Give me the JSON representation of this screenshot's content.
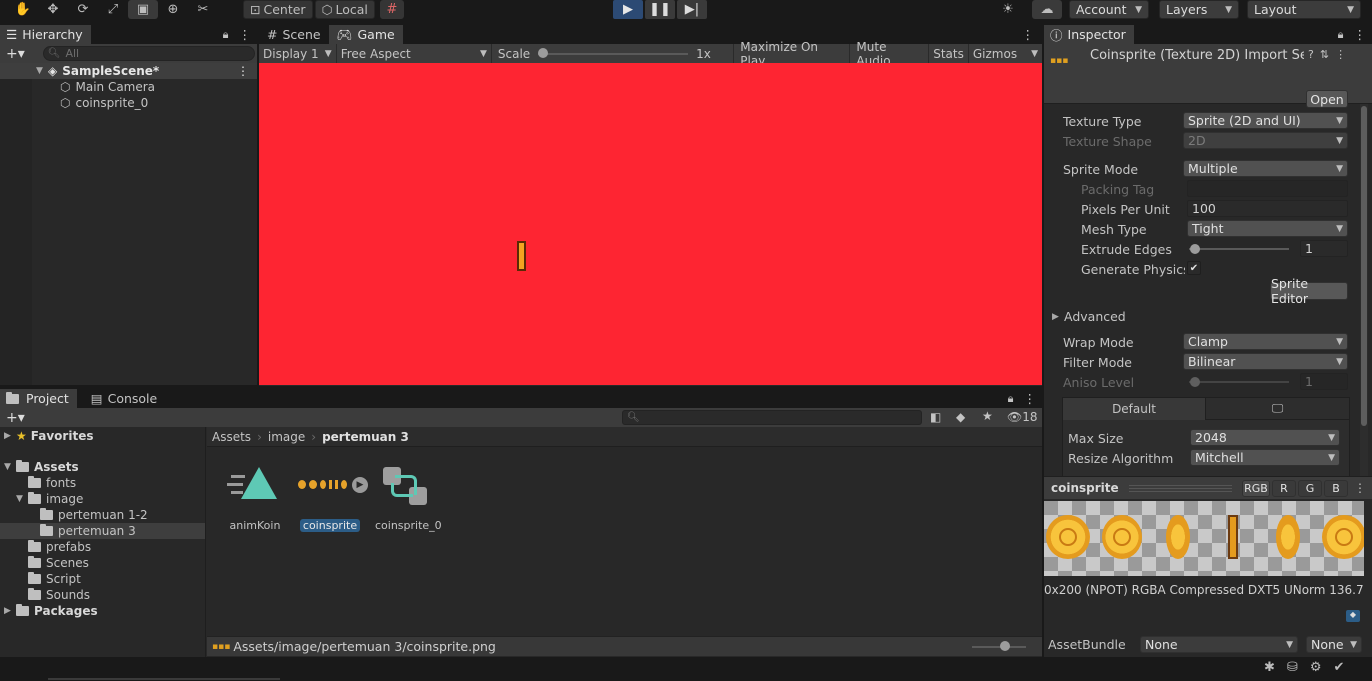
{
  "toolbar": {
    "pivot_center": "Center",
    "pivot_local": "Local",
    "account": "Account",
    "layers": "Layers",
    "layout": "Layout",
    "tools": [
      "hand-icon",
      "move-icon",
      "rotate-icon",
      "scale-icon",
      "rect-icon",
      "transform-icon",
      "custom-tool-icon"
    ]
  },
  "hierarchy": {
    "tab": "Hierarchy",
    "search_placeholder": "All",
    "scene": "SampleScene*",
    "items": [
      "Main Camera",
      "coinsprite_0"
    ]
  },
  "game": {
    "tab_scene": "Scene",
    "tab_game": "Game",
    "display": "Display 1",
    "aspect": "Free Aspect",
    "scale_label": "Scale",
    "scale_value": "1x",
    "maximize": "Maximize On Play",
    "mute": "Mute Audio",
    "stats": "Stats",
    "gizmos": "Gizmos",
    "background_color": "#fe2532"
  },
  "project": {
    "tab_project": "Project",
    "tab_console": "Console",
    "hidden_count": "18",
    "favorites": "Favorites",
    "assets": "Assets",
    "folders": [
      {
        "name": "fonts",
        "indent": 1
      },
      {
        "name": "image",
        "indent": 1
      },
      {
        "name": "pertemuan 1-2",
        "indent": 2
      },
      {
        "name": "pertemuan 3",
        "indent": 2
      },
      {
        "name": "prefabs",
        "indent": 1
      },
      {
        "name": "Scenes",
        "indent": 1
      },
      {
        "name": "Script",
        "indent": 1
      },
      {
        "name": "Sounds",
        "indent": 1
      }
    ],
    "packages": "Packages",
    "breadcrumb": [
      "Assets",
      "image",
      "pertemuan 3"
    ],
    "assets_grid": [
      "animKoin",
      "coinsprite",
      "coinsprite_0"
    ],
    "status_path": "Assets/image/pertemuan 3/coinsprite.png"
  },
  "inspector": {
    "tab": "Inspector",
    "title": "Coinsprite (Texture 2D) Import Se",
    "open": "Open",
    "texture_type_label": "Texture Type",
    "texture_type": "Sprite (2D and UI)",
    "texture_shape_label": "Texture Shape",
    "texture_shape": "2D",
    "sprite_mode_label": "Sprite Mode",
    "sprite_mode": "Multiple",
    "packing_tag_label": "Packing Tag",
    "ppu_label": "Pixels Per Unit",
    "ppu": "100",
    "mesh_type_label": "Mesh Type",
    "mesh_type": "Tight",
    "extrude_label": "Extrude Edges",
    "extrude": "1",
    "physics_label": "Generate Physics S",
    "sprite_editor": "Sprite Editor",
    "advanced": "Advanced",
    "wrap_label": "Wrap Mode",
    "wrap": "Clamp",
    "filter_label": "Filter Mode",
    "filter": "Bilinear",
    "aniso_label": "Aniso Level",
    "aniso": "1",
    "platform_default": "Default",
    "max_size_label": "Max Size",
    "max_size": "2048",
    "resize_label": "Resize Algorithm",
    "resize": "Mitchell",
    "preview_title": "coinsprite",
    "channels": [
      "RGB",
      "R",
      "G",
      "B"
    ],
    "preview_info": "0x200 (NPOT)  RGBA Compressed DXT5 UNorm   136.7",
    "assetbundle_label": "AssetBundle",
    "assetbundle": "None",
    "assetbundle_variant": "None"
  }
}
